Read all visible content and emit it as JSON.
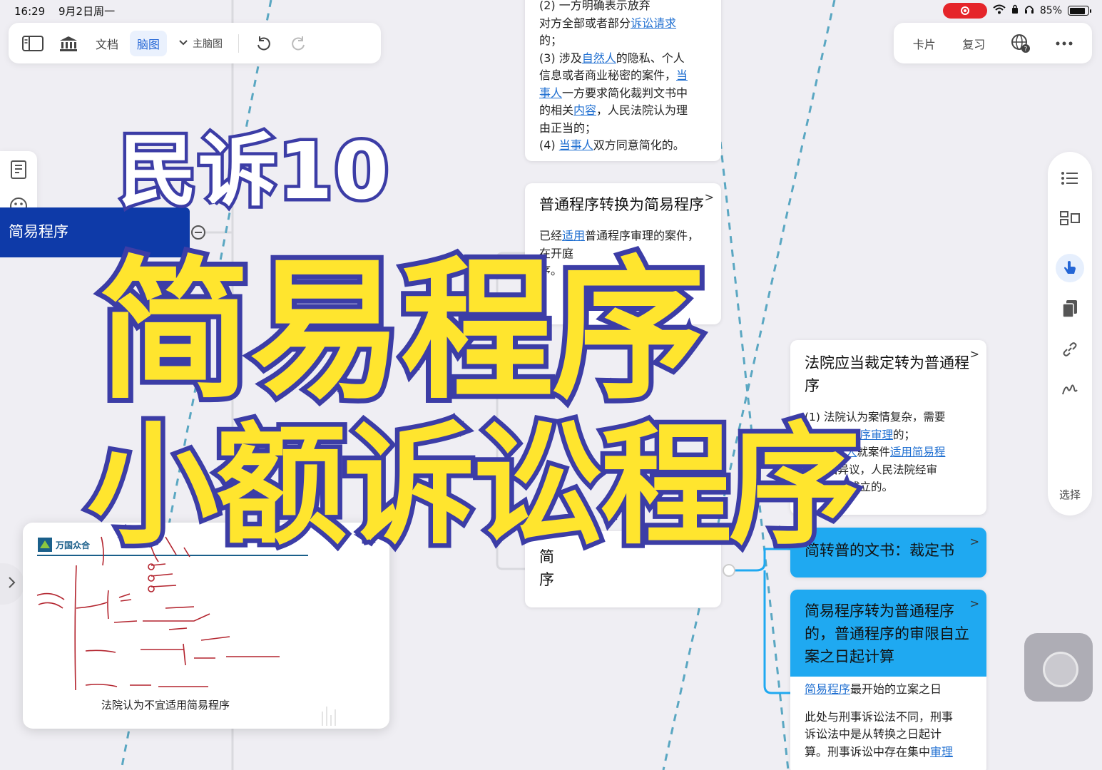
{
  "status_bar": {
    "time": "16:29",
    "date": "9月2日周一",
    "battery": "85%",
    "battery_level": 0.85
  },
  "toolbar": {
    "doc_label": "文档",
    "mindmap_label": "脑图",
    "main_map_label": "主脑图",
    "card_label": "卡片",
    "review_label": "复习"
  },
  "side": {
    "select_label": "选择"
  },
  "mindmap": {
    "root_label": "简易程序",
    "top_node": {
      "lines": [
        [
          "(2) 一方",
          "",
          "明确表示放弃"
        ],
        [
          "对方全部或者部分",
          "诉讼请求",
          ""
        ],
        [
          "的；",
          "",
          ""
        ],
        [
          "(3) 涉及",
          "自然人",
          "的隐私、个人"
        ],
        [
          "信息或者商业秘密的案件，",
          "当",
          ""
        ],
        [
          "",
          "事人",
          "一方要求简化裁判文书中"
        ],
        [
          "的相关",
          "内容",
          "，人民法院认为理"
        ],
        [
          "由正当的；",
          "",
          ""
        ],
        [
          "(4) ",
          "当事人",
          "双方同意简化的。"
        ]
      ]
    },
    "convert_node": {
      "title": "普通程序转换为简易程序",
      "body_prefix": "已经",
      "body_link": "适用",
      "body_rest": "普通程序审理的案件，",
      "body_line2": "在开庭",
      "body_line3": "序。"
    },
    "court_node": {
      "title": "法院应当裁定转为普通程序",
      "l1": "(1) 法院认为案情复杂，需要",
      "l2a": "转为普通",
      "l2b": "程序审理",
      "l2c": "的；",
      "l3a": "(2) ",
      "l3b": "当事人",
      "l3c": "就案件",
      "l3d": "适用简易程",
      "l4": "序提出异议，人民法院经审",
      "l5": "查，异议成立的。"
    },
    "doc_node": {
      "title": "简转普的文书：裁定书"
    },
    "limit_node": {
      "title": "简易程序转为普通程序的，普通程序的审限自立案之日起计算",
      "l1a": "简易程序",
      "l1b": "最开始的立案之日",
      "l2": "此处与刑事诉讼法不同，刑事",
      "l3": "诉讼法中是从转换之日起计",
      "l4a": "算。刑事诉讼中存在集中",
      "l4b": "审理"
    },
    "partial_node": {
      "line1": "简",
      "line2": "序"
    }
  },
  "video": {
    "logo_text": "万国众合",
    "caption": "法院认为不宜适用简易程序"
  },
  "overlay": {
    "series": "民诉10",
    "line1": "简易程序",
    "line2": "小额诉讼程序"
  },
  "colors": {
    "accent": "#2466d6",
    "root_bg": "#0e3aa8",
    "blue_node": "#1fa9f1",
    "overlay_fill": "#ffe52e",
    "overlay_stroke": "#3c3da6",
    "recording": "#e5252a"
  }
}
